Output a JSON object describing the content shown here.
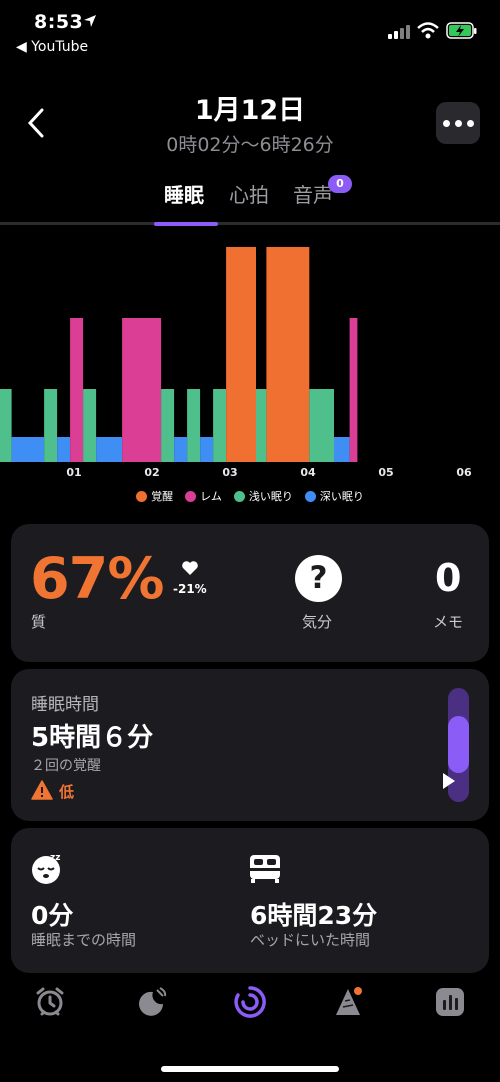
{
  "status_bar": {
    "time": "8:53",
    "back_app": "◀ YouTube"
  },
  "header": {
    "title": "1月12日",
    "subtitle": "0時02分〜6時26分"
  },
  "tabs": [
    {
      "label": "睡眠",
      "active": true
    },
    {
      "label": "心拍",
      "active": false
    },
    {
      "label": "音声",
      "active": false,
      "badge": "0"
    }
  ],
  "chart_data": {
    "type": "bar",
    "x_ticks": [
      "01",
      "02",
      "03",
      "04",
      "05",
      "06"
    ],
    "stage_levels": [
      "深い眠り",
      "浅い眠り",
      "レム",
      "覚醒"
    ],
    "series": [
      {
        "name": "覚醒",
        "color": "#ef7030"
      },
      {
        "name": "レム",
        "color": "#db3e95"
      },
      {
        "name": "浅い眠り",
        "color": "#4fbf8c"
      },
      {
        "name": "深い眠り",
        "color": "#3f8ef3"
      }
    ],
    "segments": [
      {
        "stage": "浅い眠り",
        "start": "0:02",
        "end": "0:12"
      },
      {
        "stage": "深い眠り",
        "start": "0:12",
        "end": "0:37"
      },
      {
        "stage": "浅い眠り",
        "start": "0:37",
        "end": "0:47"
      },
      {
        "stage": "深い眠り",
        "start": "0:47",
        "end": "0:57"
      },
      {
        "stage": "レム",
        "start": "0:57",
        "end": "1:07"
      },
      {
        "stage": "浅い眠り",
        "start": "1:07",
        "end": "1:17"
      },
      {
        "stage": "深い眠り",
        "start": "1:17",
        "end": "1:37"
      },
      {
        "stage": "レム",
        "start": "1:37",
        "end": "2:07"
      },
      {
        "stage": "浅い眠り",
        "start": "2:07",
        "end": "2:17"
      },
      {
        "stage": "深い眠り",
        "start": "2:17",
        "end": "2:27"
      },
      {
        "stage": "浅い眠り",
        "start": "2:27",
        "end": "2:37"
      },
      {
        "stage": "深い眠り",
        "start": "2:37",
        "end": "2:47"
      },
      {
        "stage": "浅い眠り",
        "start": "2:47",
        "end": "2:57"
      },
      {
        "stage": "覚醒",
        "start": "2:57",
        "end": "3:20"
      },
      {
        "stage": "浅い眠り",
        "start": "3:20",
        "end": "3:28"
      },
      {
        "stage": "覚醒",
        "start": "3:28",
        "end": "4:01"
      },
      {
        "stage": "浅い眠り",
        "start": "4:01",
        "end": "4:20"
      },
      {
        "stage": "深い眠り",
        "start": "4:20",
        "end": "4:32"
      },
      {
        "stage": "レム",
        "start": "4:32",
        "end": "4:38"
      }
    ]
  },
  "quality": {
    "value": "67%",
    "label": "質",
    "delta": "-21%",
    "mood_label": "気分",
    "mood_icon": "question-icon",
    "memo_count": "0",
    "memo_label": "メモ"
  },
  "duration": {
    "label": "睡眠時間",
    "value": "5時間６分",
    "wake_count": "２回の覚醒",
    "warning": "低",
    "level": 0.5
  },
  "bed": {
    "fall_asleep_value": "0分",
    "fall_asleep_label": "睡眠までの時間",
    "in_bed_value": "6時間23分",
    "in_bed_label": "ベッドにいた時間"
  },
  "nav": [
    "alarm-clock-icon",
    "moon-satellite-icon",
    "sleep-ring-icon",
    "sound-tree-icon",
    "stats-icon"
  ],
  "colors": {
    "accent": "#8b5cf6",
    "orange": "#f07432"
  }
}
